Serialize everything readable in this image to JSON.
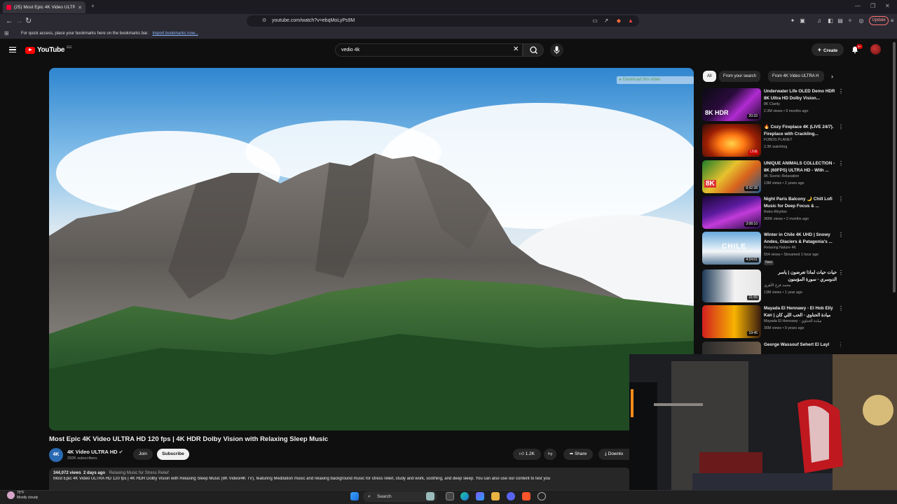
{
  "browser": {
    "tab_title": "(25) Most Epic 4K Video ULTRA H",
    "url": "youtube.com/watch?v=ebqMoLyPs9M",
    "update_label": "Update",
    "bookmarks_hint": "For quick access, place your bookmarks here on the bookmarks bar.",
    "bookmarks_link": "Import bookmarks now..."
  },
  "header": {
    "logo_text": "YouTube",
    "logo_country": "EG",
    "search_value": "vedio 4k",
    "create_label": "Create",
    "notification_count": "9+"
  },
  "player": {
    "download_overlay": "Download this video"
  },
  "video": {
    "title": "Most Epic 4K Video ULTRA HD 120 fps | 4K HDR Dolby Vision with Relaxing Sleep Music",
    "channel_avatar_text": "4K",
    "channel_name": "4K Video ULTRA HD",
    "subscribers": "292K subscribers",
    "join_label": "Join",
    "subscribe_label": "Subscribe",
    "likes": "1.2K",
    "share_label": "Share",
    "download_label": "Downlo",
    "views": "344,072 views",
    "age": "2 days ago",
    "hashtag": "Relaxing Music for Stress Relief",
    "description": "Most Epic 4K Video ULTRA HD 120 fps | 4K HDR Dolby Vision with Relaxing Sleep Music (8K Video/4K TV), featuring Meditation music and relaxing background music for stress relief, study and work, soothing, and deep sleep. You can also use our content to test you"
  },
  "chips": [
    "All",
    "From your search",
    "From 4K Video ULTRA H"
  ],
  "recommendations": [
    {
      "title": "Underwater Life OLED Demo HDR 8K Ultra HD Dolby Vision...",
      "channel": "8K Clarity",
      "meta": "2.3M views • 9 months ago",
      "duration": "20:33",
      "live": false,
      "new": ""
    },
    {
      "title": "🔥 Cozy Fireplace 4K (LIVE 24/7). Fireplace with Crackling...",
      "channel": "FOBOS PLANET",
      "meta": "2.3K watching",
      "duration": "LIVE",
      "live": true,
      "new": ""
    },
    {
      "title": "UNIQUE ANIMALS COLLECTION - 8K (60FPS) ULTRA HD - With ...",
      "channel": "8K Scenic Relaxation",
      "meta": "13M views • 2 years ago",
      "duration": "8:42:38",
      "live": false,
      "new": ""
    },
    {
      "title": "Night Paris Balcony 🌙 Chill Lofi Music for Deep Focus & ...",
      "channel": "Retro-Rhythm",
      "meta": "366K views • 2 months ago",
      "duration": "3:08:10",
      "live": false,
      "new": ""
    },
    {
      "title": "Winter in Chile 4K UHD | Snowy Andes, Glaciers & Patagonia's ...",
      "channel": "Relaxing Nature 4K",
      "meta": "554 views • Streamed 1 hour ago",
      "duration": "4:24:01",
      "live": false,
      "new": "New"
    },
    {
      "title": "حيات حيات لماذا تعرضون | ياسر الدوسري - سورة المؤمنون",
      "channel": "محمد فرج الأهري",
      "meta": "13M views • 1 year ago",
      "duration": "21:55",
      "live": false,
      "new": ""
    },
    {
      "title": "Mayada El Hennawy - El Hob Elly Kan | ميادة الحناوي - الحب اللي كان",
      "channel": "Mayada El Hennawy - ميادة الحناوي",
      "meta": "36M views • 9 years ago",
      "duration": "19:46",
      "live": false,
      "new": ""
    },
    {
      "title": "George Wassouf Sehert El Layl",
      "channel": "",
      "meta": "",
      "duration": "",
      "live": false,
      "new": ""
    }
  ],
  "taskbar": {
    "temperature": "70°F",
    "weather": "Mostly cloudy",
    "search_label": "Search"
  },
  "colors": {
    "background": "#0f0f0f",
    "accent_red": "#ff0000",
    "surface": "#272727"
  }
}
